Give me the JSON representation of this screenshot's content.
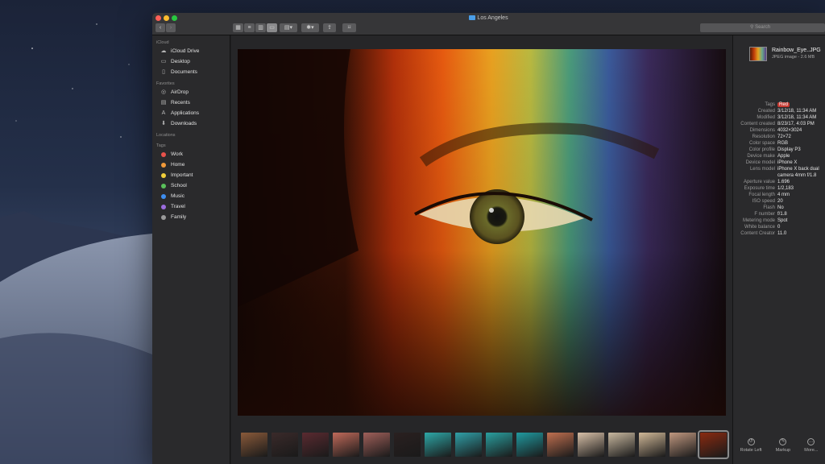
{
  "window": {
    "title": "Los Angeles"
  },
  "search": {
    "placeholder": "Search"
  },
  "toolbar": {
    "share_label": "⇪",
    "tag_label": "⌂"
  },
  "sidebar": {
    "sections": {
      "icloud": "iCloud",
      "favorites": "Favorites",
      "locations": "Locations",
      "tags": "Tags"
    },
    "icloud_items": [
      {
        "label": "iCloud Drive",
        "icon": "cloud-icon"
      },
      {
        "label": "Desktop",
        "icon": "desktop-icon"
      },
      {
        "label": "Documents",
        "icon": "document-icon"
      }
    ],
    "favorites_items": [
      {
        "label": "AirDrop",
        "icon": "airdrop-icon"
      },
      {
        "label": "Recents",
        "icon": "recents-icon"
      },
      {
        "label": "Applications",
        "icon": "applications-icon"
      },
      {
        "label": "Downloads",
        "icon": "downloads-icon"
      }
    ],
    "tags": [
      {
        "label": "Work",
        "color": "#e8524b"
      },
      {
        "label": "Home",
        "color": "#f19a3a"
      },
      {
        "label": "Important",
        "color": "#f2cf3b"
      },
      {
        "label": "School",
        "color": "#5ac05a"
      },
      {
        "label": "Music",
        "color": "#3e8ef0"
      },
      {
        "label": "Travel",
        "color": "#9b6cde"
      },
      {
        "label": "Family",
        "color": "#9a9a9a"
      }
    ]
  },
  "inspector": {
    "file_name": "Rainbow_Eye..JPG",
    "file_info": "JPEG image - 2.6 MB",
    "metadata": [
      {
        "key": "Tags",
        "value": "Red"
      },
      {
        "key": "Created",
        "value": "3/12/18, 11:34 AM"
      },
      {
        "key": "Modified",
        "value": "3/12/18, 11:34 AM"
      },
      {
        "key": "Content created",
        "value": "8/23/17, 4:03 PM"
      },
      {
        "key": "Dimensions",
        "value": "4032×3024"
      },
      {
        "key": "Resolution",
        "value": "72×72"
      },
      {
        "key": "Color space",
        "value": "RGB"
      },
      {
        "key": "Color profile",
        "value": "Display P3"
      },
      {
        "key": "Device make",
        "value": "Apple"
      },
      {
        "key": "Device model",
        "value": "iPhone X"
      },
      {
        "key": "Lens model",
        "value": "iPhone X back dual camera 4mm f/1.8"
      },
      {
        "key": "Aperture value",
        "value": "1.696"
      },
      {
        "key": "Exposure time",
        "value": "1/2,183"
      },
      {
        "key": "Focal length",
        "value": "4 mm"
      },
      {
        "key": "ISO speed",
        "value": "20"
      },
      {
        "key": "Flash",
        "value": "No"
      },
      {
        "key": "F number",
        "value": "f/1.8"
      },
      {
        "key": "Metering mode",
        "value": "Spot"
      },
      {
        "key": "White balance",
        "value": "0"
      },
      {
        "key": "Content Creator",
        "value": "11.0"
      }
    ],
    "actions": [
      {
        "label": "Rotate Left",
        "icon": "rotate-left-icon"
      },
      {
        "label": "Markup",
        "icon": "markup-icon"
      },
      {
        "label": "More...",
        "icon": "more-icon"
      }
    ]
  },
  "thumbnails": [
    "#8a5a3a",
    "#3a2a2a",
    "#5a2a30",
    "#c06a5a",
    "#a0605a",
    "#2a2020",
    "#2ea8a8",
    "#30a0a8",
    "#2aa0a0",
    "#209aa0",
    "#c07050",
    "#d8c0a8",
    "#c8b8a0",
    "#d0b898",
    "#c09880",
    "#8a2a10"
  ]
}
